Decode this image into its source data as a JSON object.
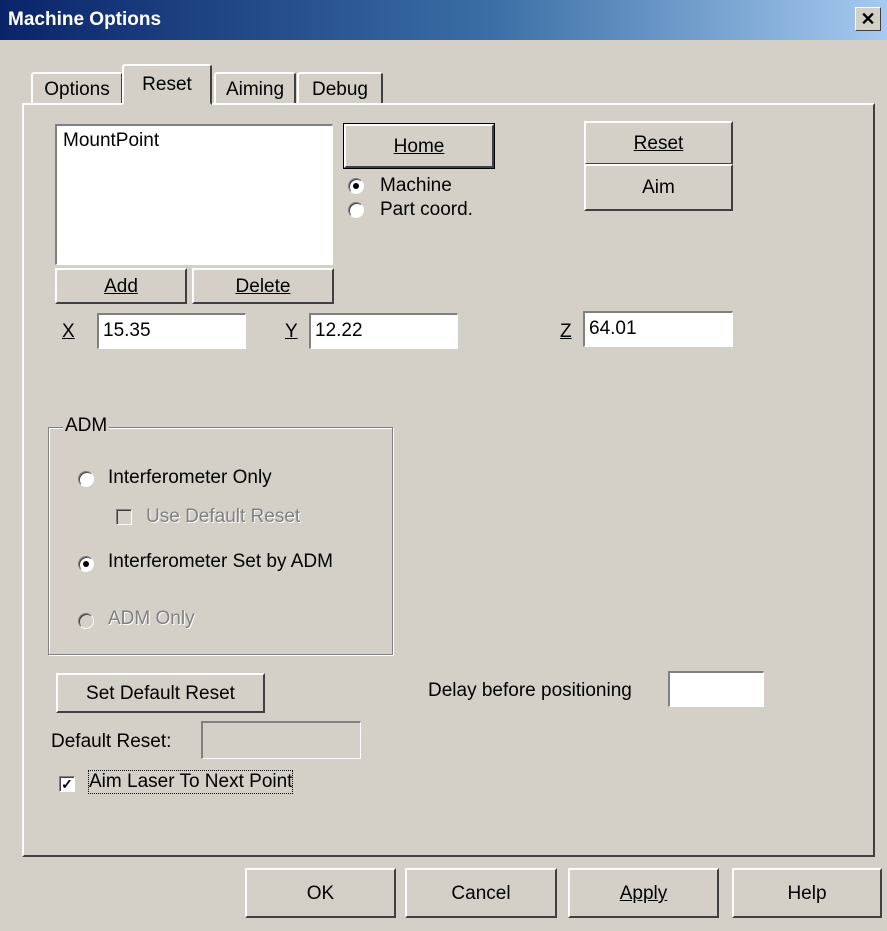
{
  "window": {
    "title": "Machine Options",
    "close_glyph": "✕"
  },
  "tabs": [
    {
      "label": "Options"
    },
    {
      "label": "Reset"
    },
    {
      "label": "Aiming"
    },
    {
      "label": "Debug"
    }
  ],
  "reset_tab": {
    "list": {
      "items": [
        "MountPoint"
      ]
    },
    "add_button": {
      "label": "Add"
    },
    "delete_button": {
      "label": "Delete"
    },
    "home_button": {
      "label": "Home"
    },
    "coord_radio": {
      "machine": "Machine",
      "part": "Part coord.",
      "selected": "Machine"
    },
    "reset_button": {
      "label": "Reset"
    },
    "aim_button": {
      "label": "Aim"
    },
    "coords": {
      "x_label": "X",
      "x_value": "15.35",
      "y_label": "Y",
      "y_value": "12.22",
      "z_label": "Z",
      "z_value": "64.01"
    },
    "adm_group": {
      "title": "ADM",
      "interferometer_only": "Interferometer Only",
      "use_default_reset": "Use Default Reset",
      "interferometer_set_by_adm": "Interferometer Set by ADM",
      "adm_only": "ADM Only",
      "selected": "Interferometer Set by ADM"
    },
    "set_default_reset_button": {
      "label": "Set Default Reset"
    },
    "default_reset": {
      "label": "Default Reset:",
      "value": ""
    },
    "delay": {
      "label": "Delay before positioning",
      "value": ""
    },
    "aim_laser_checkbox": {
      "label": "Aim Laser To Next Point",
      "checked": true,
      "check_glyph": "✓"
    }
  },
  "footer": {
    "ok": "OK",
    "cancel": "Cancel",
    "apply": "Apply",
    "help": "Help"
  }
}
